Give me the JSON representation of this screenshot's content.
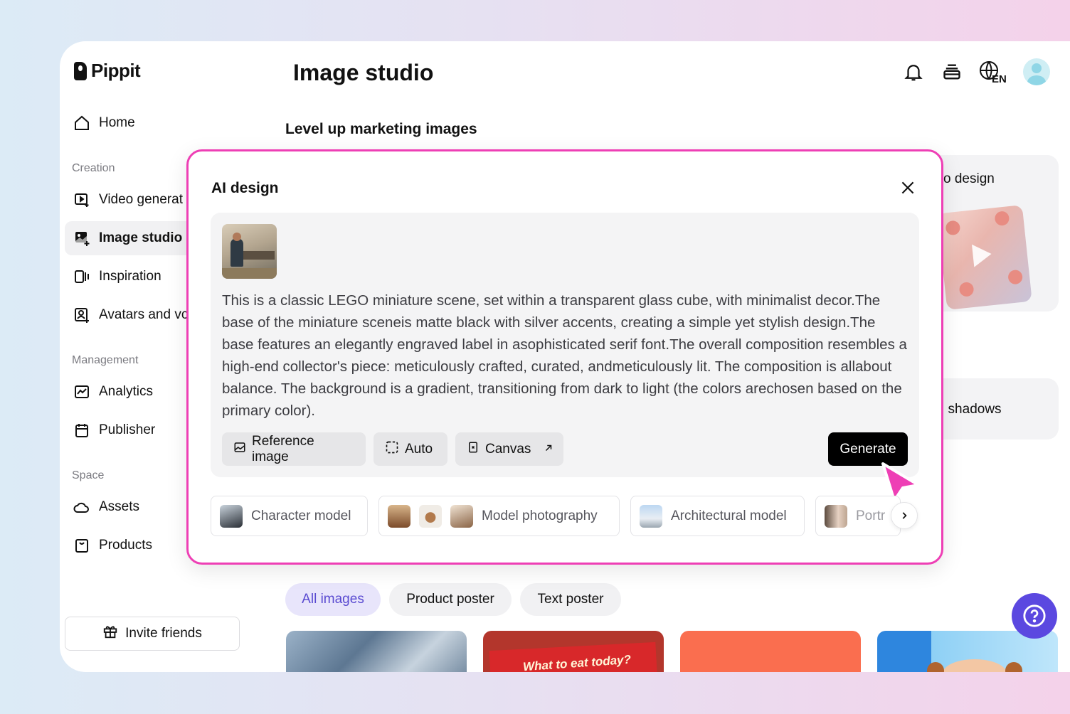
{
  "app": {
    "name": "Pippit"
  },
  "header": {
    "title": "Image studio",
    "language": "EN"
  },
  "sidebar": {
    "home": "Home",
    "sections": [
      {
        "label": "Creation",
        "items": [
          "Video generat",
          "Image studio",
          "Inspiration",
          "Avatars and vc"
        ]
      },
      {
        "label": "Management",
        "items": [
          "Analytics",
          "Publisher"
        ]
      },
      {
        "label": "Space",
        "items": [
          "Assets",
          "Products"
        ]
      }
    ],
    "invite": "Invite friends"
  },
  "main": {
    "section_title": "Level up marketing images",
    "cards": [
      "o design",
      "I shadows"
    ],
    "tabs": [
      "All images",
      "Product poster",
      "Text poster"
    ],
    "gallery_caption": "What to eat today?"
  },
  "modal": {
    "title": "AI design",
    "prompt": "This is a classic LEGO miniature scene, set within a transparent glass cube, with minimalist decor.The base of the miniature sceneis matte black with silver accents, creating a simple yet stylish design.The base features an elegantly engraved label in asophisticated serif font.The overall composition resembles a high-end collector's piece: meticulously crafted, curated, andmeticulously lit. The composition is allabout balance. The background is a gradient, transitioning from dark to light (the colors arechosen based on the primary color).",
    "buttons": {
      "reference": "Reference image",
      "auto": "Auto",
      "canvas": "Canvas",
      "generate": "Generate"
    },
    "chips": [
      "Character model",
      "Model photography",
      "Architectural model",
      "Portr"
    ]
  },
  "colors": {
    "accent": "#ee3fb5",
    "help": "#5b48e0",
    "tab_active_text": "#5a4bd1"
  }
}
